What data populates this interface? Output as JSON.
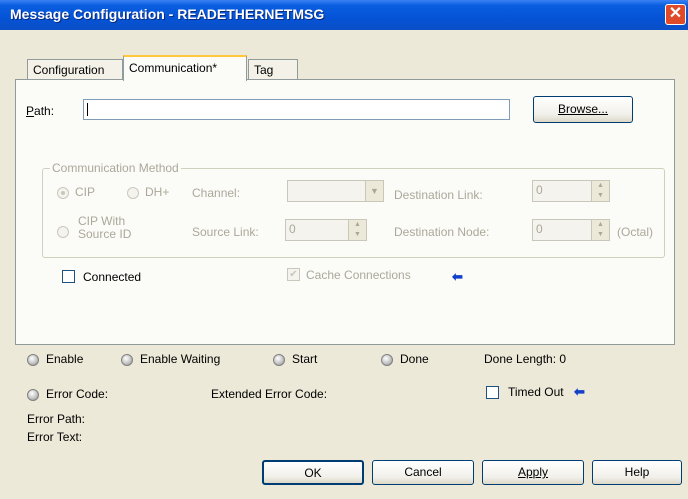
{
  "window": {
    "title": "Message Configuration - READETHERNETMSG",
    "close_glyph": "✕"
  },
  "tabs": {
    "configuration": "Configuration",
    "communication": "Communication*",
    "tag": "Tag"
  },
  "path": {
    "label_prefix": "P",
    "label_rest": "ath:",
    "value": "",
    "browse_label": "Browse..."
  },
  "comm_method": {
    "legend": "Communication Method",
    "cip": "CIP",
    "dh_plus": "DH+",
    "cip_with_source_line1": "CIP With",
    "cip_with_source_line2": "Source ID",
    "channel_label": "Channel:",
    "channel_value": "",
    "source_link_label": "Source Link:",
    "source_link_value": "0",
    "destination_link_label": "Destination Link:",
    "destination_link_value": "0",
    "destination_node_label": "Destination Node:",
    "destination_node_value": "0",
    "octal": "(Octal)",
    "selected": "CIP"
  },
  "options": {
    "connected_label": "Connected",
    "connected_checked": false,
    "cache_label": "Cache Connections",
    "cache_checked": true,
    "arrow": "⬅"
  },
  "status": {
    "enable": "Enable",
    "enable_waiting": "Enable Waiting",
    "start": "Start",
    "done": "Done",
    "done_length": "Done Length: 0",
    "error_code": "Error Code:",
    "extended_error_code": "Extended Error Code:",
    "timed_out": "Timed Out",
    "timed_out_arrow": "⬅",
    "error_path": "Error Path:",
    "error_text": "Error Text:"
  },
  "buttons": {
    "ok": "OK",
    "cancel": "Cancel",
    "apply": "Apply",
    "help": "Help"
  }
}
